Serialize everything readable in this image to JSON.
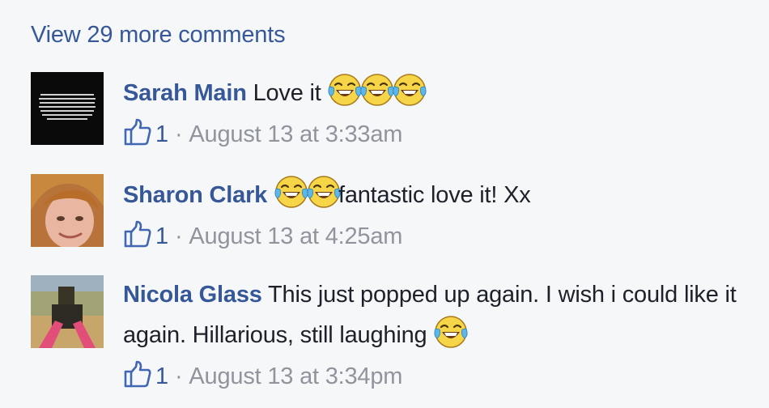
{
  "view_more_label": "View 29 more comments",
  "colors": {
    "link": "#365899",
    "text": "#1d2129",
    "meta": "#90949c",
    "background": "#f6f7f9"
  },
  "comments": [
    {
      "author": "Sarah Main",
      "text_before": "Love it",
      "emojis_before_text": 0,
      "emojis_after_text": 3,
      "text_after": "",
      "emoji_name": "face-with-tears-of-joy",
      "like_count": "1",
      "separator": "·",
      "timestamp": "August 13 at 3:33am"
    },
    {
      "author": "Sharon Clark",
      "text_before": "",
      "emojis_before_text": 2,
      "text_after": "fantastic love it! Xx",
      "emoji_name": "face-with-tears-of-joy",
      "like_count": "1",
      "separator": "·",
      "timestamp": "August 13 at 4:25am"
    },
    {
      "author": "Nicola Glass",
      "text_before": "This just popped up again. I wish i could like it again. Hillarious, still laughing",
      "emojis_after_text": 1,
      "emoji_name": "face-with-tears-of-joy",
      "like_count": "1",
      "separator": "·",
      "timestamp": "August 13 at 3:34pm"
    }
  ]
}
